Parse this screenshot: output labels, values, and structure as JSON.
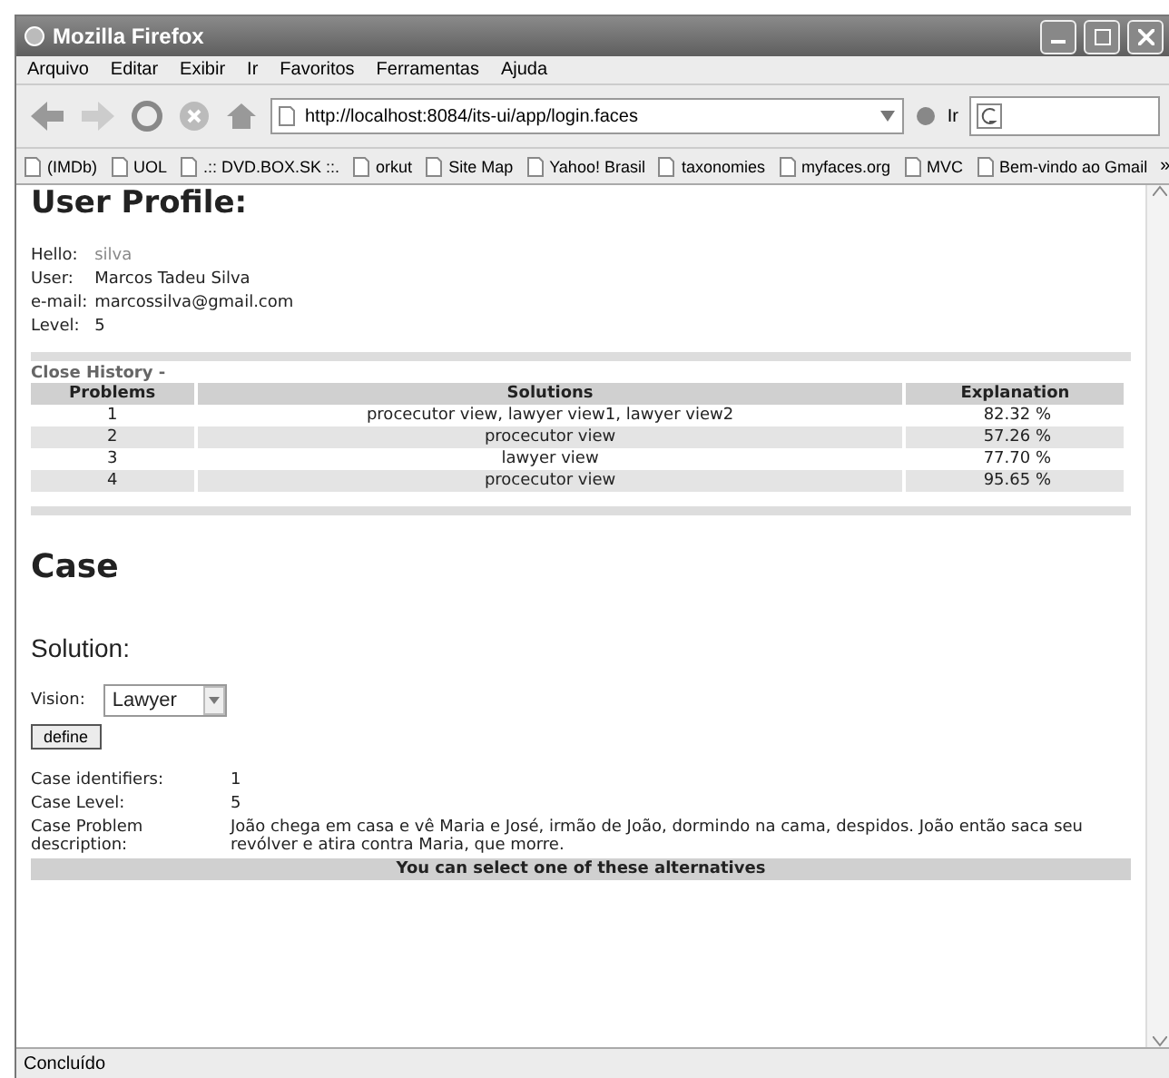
{
  "window": {
    "title": "Mozilla Firefox"
  },
  "menu": [
    "Arquivo",
    "Editar",
    "Exibir",
    "Ir",
    "Favoritos",
    "Ferramentas",
    "Ajuda"
  ],
  "address": {
    "value": "http://localhost:8084/its-ui/app/login.faces"
  },
  "go_label": "Ir",
  "bookmarks": [
    {
      "label": "(IMDb)"
    },
    {
      "label": "UOL"
    },
    {
      "label": ".:: DVD.BOX.SK ::."
    },
    {
      "label": "orkut"
    },
    {
      "label": "Site Map"
    },
    {
      "label": "Yahoo! Brasil"
    },
    {
      "label": "taxonomies"
    },
    {
      "label": "myfaces.org"
    },
    {
      "label": "MVC"
    },
    {
      "label": "Bem-vindo ao Gmail"
    }
  ],
  "bookmarks_more": "»",
  "profile": {
    "heading": "User Profile:",
    "fields": [
      {
        "label": "Hello:",
        "value": "silva",
        "muted": true
      },
      {
        "label": "User:",
        "value": "Marcos Tadeu Silva",
        "muted": false
      },
      {
        "label": "e-mail:",
        "value": "marcossilva@gmail.com",
        "muted": false
      },
      {
        "label": "Level:",
        "value": "5",
        "muted": false
      }
    ]
  },
  "history": {
    "title": "Close History -",
    "columns": [
      "Problems",
      "Solutions",
      "Explanation"
    ],
    "rows": [
      [
        "1",
        "procecutor view, lawyer view1, lawyer view2",
        "82.32 %"
      ],
      [
        "2",
        "procecutor view",
        "57.26 %"
      ],
      [
        "3",
        "lawyer view",
        "77.70 %"
      ],
      [
        "4",
        "procecutor view",
        "95.65 %"
      ]
    ]
  },
  "case": {
    "heading": "Case",
    "solution_heading": "Solution:",
    "vision_label": "Vision:",
    "vision_value": "Lawyer",
    "define_button": "define",
    "fields": [
      {
        "label": "Case identifiers:",
        "value": "1"
      },
      {
        "label": "Case Level:",
        "value": "5"
      },
      {
        "label": "Case Problem description:",
        "value": "João chega em casa e vê Maria e José, irmão de João, dormindo na cama, despidos. João então saca seu revólver e atira contra Maria, que morre."
      }
    ],
    "alternatives_header": "You can select one of these alternatives"
  },
  "status_bar": "Concluído"
}
